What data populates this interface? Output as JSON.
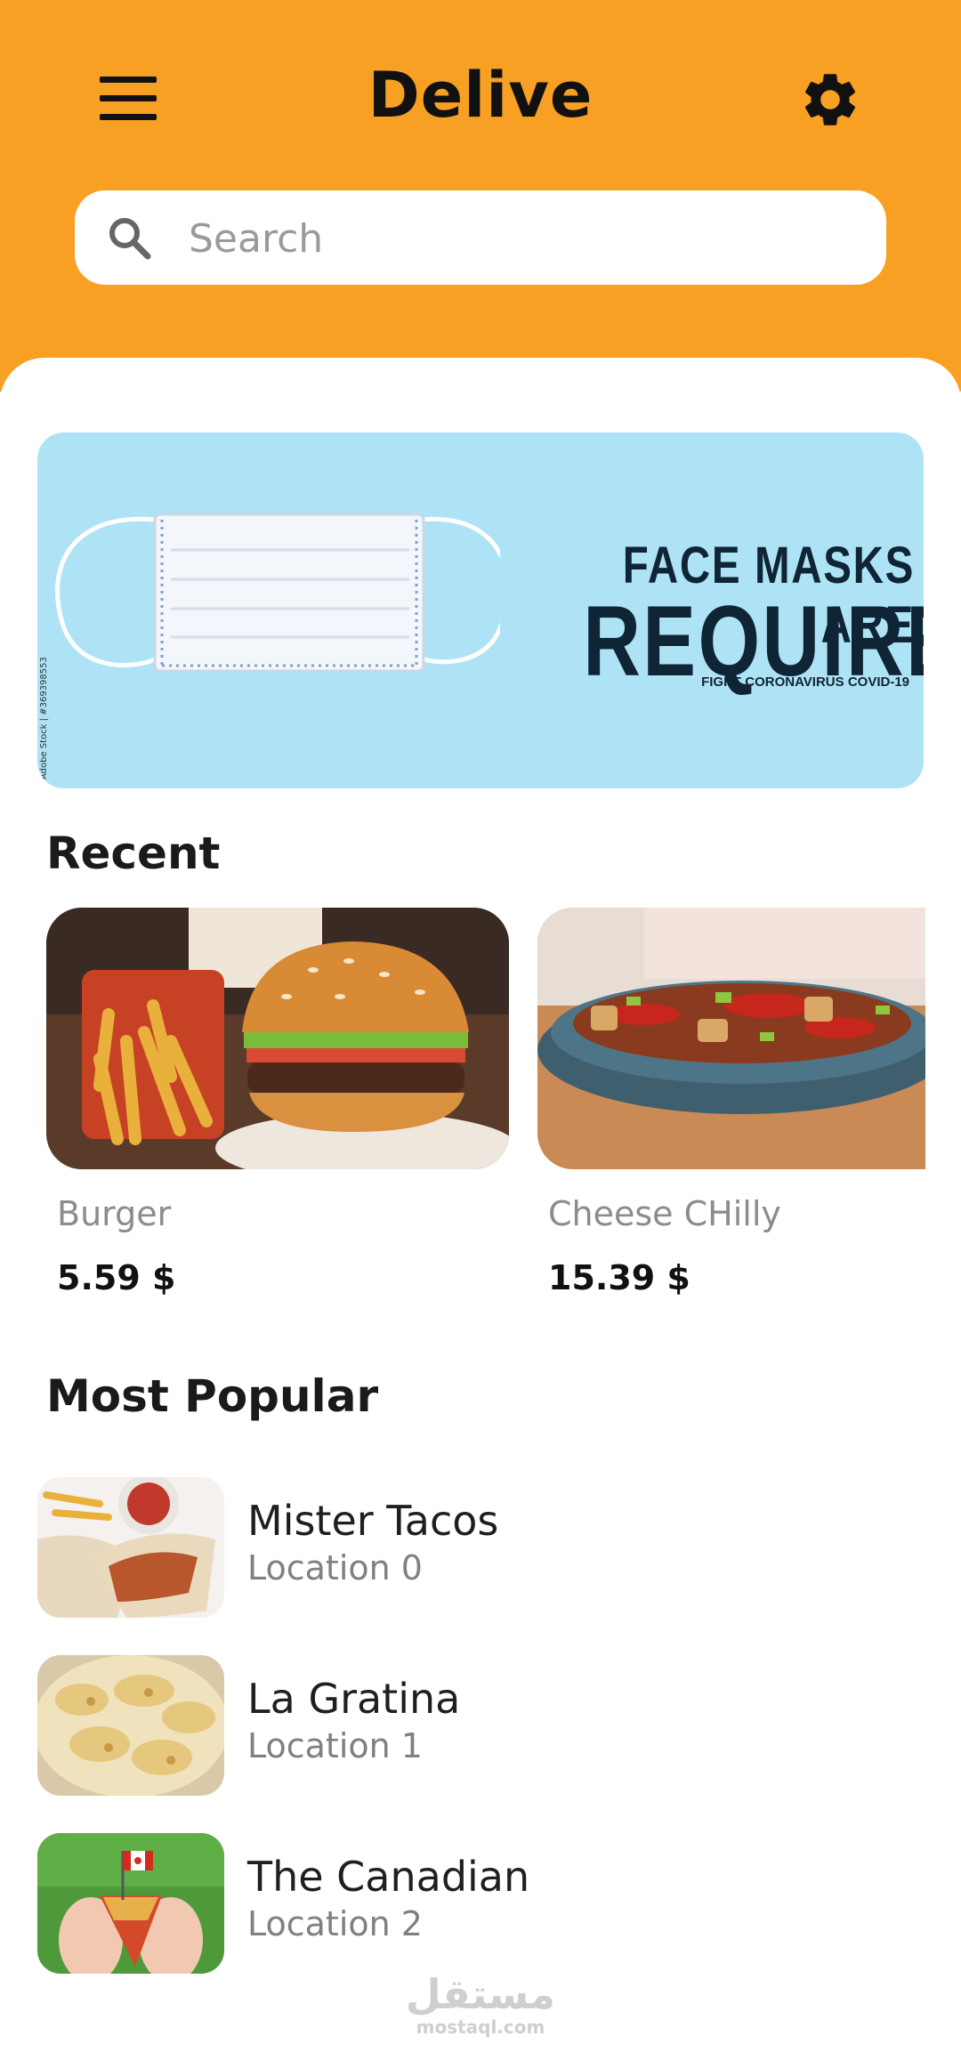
{
  "app": {
    "title": "Delive"
  },
  "header": {
    "menu_icon": "hamburger-menu-icon",
    "settings_icon": "gear-icon"
  },
  "search": {
    "placeholder": "Search",
    "value": ""
  },
  "banner": {
    "line1": "FACE MASKS ARE",
    "line2": "REQUIRED",
    "line3": "FIGHT CORONAVIRUS COVID-19",
    "side_text": "Adobe Stock | #369398553",
    "background_color": "#aee3f6"
  },
  "recent": {
    "title": "Recent",
    "items": [
      {
        "name": "Burger",
        "price": "5.59 $"
      },
      {
        "name": "Cheese CHilly",
        "price": "15.39 $"
      }
    ]
  },
  "popular": {
    "title": "Most Popular",
    "items": [
      {
        "name": "Mister Tacos",
        "location": "Location 0"
      },
      {
        "name": "La Gratina",
        "location": "Location 1"
      },
      {
        "name": "The Canadian",
        "location": "Location 2"
      }
    ]
  },
  "watermark": {
    "arabic": "مستقل",
    "latin": "mostaql.com"
  },
  "colors": {
    "accent": "#f7a024",
    "text": "#111111",
    "muted": "#8c8c8c"
  }
}
